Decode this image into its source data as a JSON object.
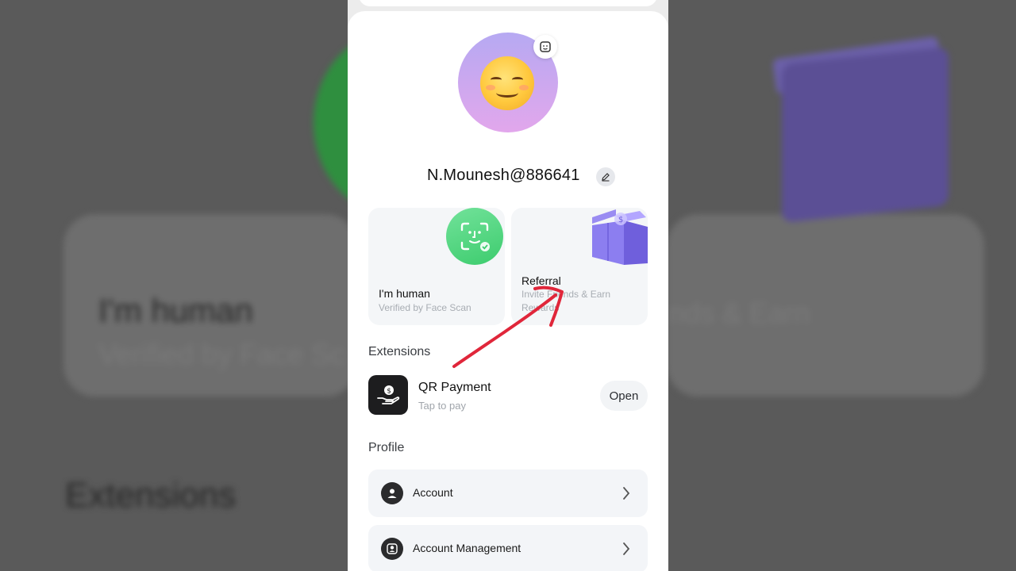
{
  "profile": {
    "username": "N.Mounesh@886641"
  },
  "cards": {
    "human": {
      "title": "I'm human",
      "subtitle": "Verified by Face Scan"
    },
    "referral": {
      "title": "Referral",
      "subtitle": "Invite Friends & Earn Rewards"
    }
  },
  "extensions": {
    "heading": "Extensions",
    "items": [
      {
        "title": "QR Payment",
        "subtitle": "Tap to pay",
        "action": "Open",
        "icon": "hand-coin-icon"
      }
    ]
  },
  "profile_section": {
    "heading": "Profile",
    "items": [
      {
        "label": "Account",
        "icon": "person-icon"
      },
      {
        "label": "Account Management",
        "icon": "person-badge-icon"
      }
    ]
  },
  "background": {
    "human_title": "I'm human",
    "human_subtitle": "Verified by Face Sc",
    "referral_fragment": "nds & Earn",
    "extensions": "Extensions"
  },
  "colors": {
    "annotation_arrow": "#e0263a",
    "human_badge": "#3dcc6e",
    "avatar_gradient_top": "#b6a9f2",
    "avatar_gradient_bottom": "#e2a7ec"
  }
}
